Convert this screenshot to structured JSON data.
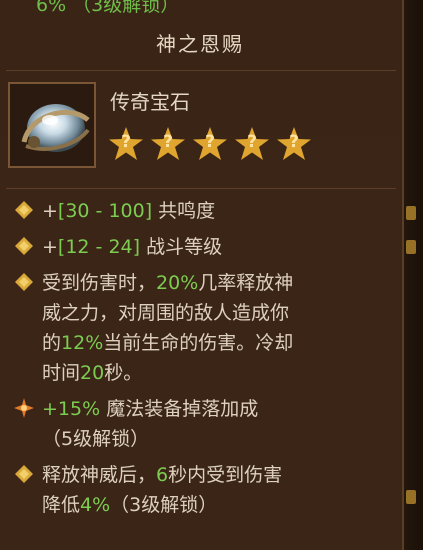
{
  "top_partial": "6% （3级解锁）",
  "title": "神之恩赐",
  "item": {
    "type_label": "传奇宝石",
    "icon": "legendary-gem-icon",
    "stars": [
      "?",
      "?",
      "?",
      "?",
      "?"
    ]
  },
  "properties": [
    {
      "icon": "diamond-bullet-icon",
      "parts": [
        "+",
        "[30 - 100]",
        " 共鸣度"
      ]
    },
    {
      "icon": "diamond-bullet-icon",
      "parts": [
        "+",
        "[12 - 24]",
        " 战斗等级"
      ]
    },
    {
      "icon": "diamond-bullet-icon",
      "line1": [
        "受到伤害时，",
        "20%",
        "几率释放神"
      ],
      "line2": "威之力，对周围的敌人造成你",
      "line3": [
        "的",
        "12%",
        "当前生命的伤害。冷却"
      ],
      "line4": [
        "时间",
        "20",
        "秒。"
      ]
    },
    {
      "icon": "starburst-bullet-icon",
      "line1": [
        "+15%",
        " 魔法装备掉落加成"
      ],
      "line2": "（5级解锁）"
    },
    {
      "icon": "diamond-bullet-icon",
      "line1": [
        "释放神威后，",
        "6",
        "秒内受到伤害"
      ],
      "line2": [
        "降低",
        "4%",
        "（3级解锁）"
      ]
    }
  ],
  "colors": {
    "highlight": "#7dcc52",
    "text": "#ddd0bd",
    "bullet": "#d9a93a"
  }
}
